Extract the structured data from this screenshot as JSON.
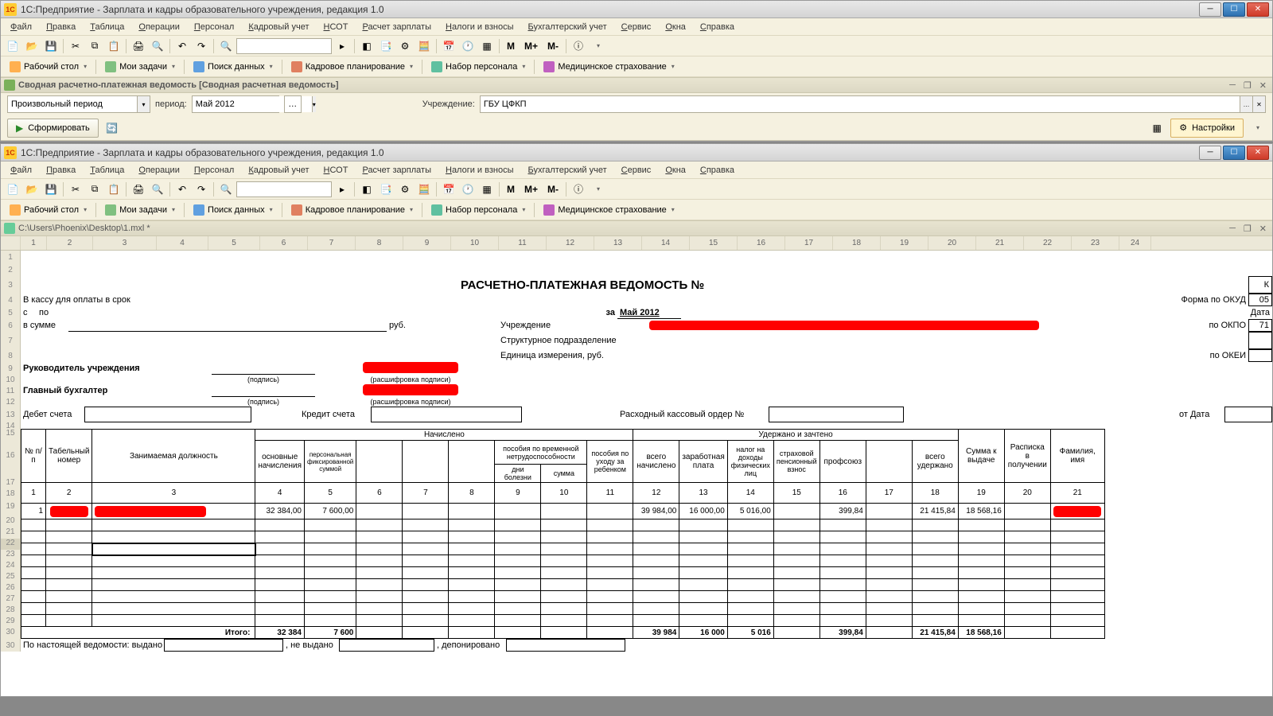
{
  "window1": {
    "title": "1С:Предприятие - Зарплата и кадры образовательного учреждения, редакция 1.0",
    "menu": [
      "Файл",
      "Правка",
      "Таблица",
      "Операции",
      "Персонал",
      "Кадровый учет",
      "НСОТ",
      "Расчет зарплаты",
      "Налоги и взносы",
      "Бухгалтерский учет",
      "Сервис",
      "Окна",
      "Справка"
    ],
    "toolbar_m": [
      "M",
      "M+",
      "M-"
    ],
    "toolbar2": [
      {
        "label": "Рабочий стол"
      },
      {
        "label": "Мои задачи"
      },
      {
        "label": "Поиск данных"
      },
      {
        "label": "Кадровое планирование"
      },
      {
        "label": "Набор персонала"
      },
      {
        "label": "Медицинское страхование"
      }
    ],
    "subwin": {
      "title": "Сводная расчетно-платежная ведомость [Сводная расчетная ведомость]",
      "period_type": "Произвольный период",
      "period_label": "период:",
      "period_value": "Май 2012",
      "org_label": "Учреждение:",
      "org_value": "ГБУ ЦФКП",
      "form_btn": "Сформировать",
      "settings_btn": "Настройки"
    }
  },
  "window2": {
    "title": "1С:Предприятие - Зарплата и кадры образовательного учреждения, редакция 1.0",
    "doc_path": "C:\\Users\\Phoenix\\Desktop\\1.mxl *",
    "sheet": {
      "col_headers": [
        "1",
        "2",
        "3",
        "4",
        "5",
        "6",
        "7",
        "8",
        "9",
        "10",
        "11",
        "12",
        "13",
        "14",
        "15",
        "16",
        "17",
        "18",
        "19",
        "20",
        "21",
        "22",
        "23",
        "24"
      ],
      "title": "РАСЧЕТНО-ПЛАТЕЖНАЯ ВЕДОМОСТЬ №",
      "r4": "В кассу для оплаты в срок",
      "r5a": "с",
      "r5b": "по",
      "r5_za": "за",
      "r5_month": "Май 2012",
      "r6a": "в сумме",
      "r6_rub": "руб.",
      "r6_org": "Учреждение",
      "r7_dept": "Структурное подразделение",
      "r8_unit": "Единица измерения, руб.",
      "r9_head": "Руководитель учреждения",
      "r_sign": "(подпись)",
      "r_decode": "(расшифровка подписи)",
      "r11_acc": "Главный бухгалтер",
      "r13_debit": "Дебет счета",
      "r13_credit": "Кредит счета",
      "r13_rko": "Расходный кассовый ордер №",
      "r13_date": "от Дата",
      "form_okud": "Форма по ОКУД",
      "okud_val": "05",
      "date_lbl": "Дата",
      "okpo_lbl": "по ОКПО",
      "okpo_val": "71",
      "okei_lbl": "по ОКЕИ",
      "table": {
        "group_accrued": "Начислено",
        "group_withheld": "Удержано и зачтено",
        "cols": {
          "num": "№ п/п",
          "tab_num": "Табельный номер",
          "position": "Занимаемая должность",
          "base": "основные начисления",
          "fixed": "персональная фиксированной суммой",
          "sick_group": "пособия по временной нетрудоспособности",
          "sick_days": "дни болезни",
          "sick_sum": "сумма",
          "child": "пособия по уходу за ребенком",
          "total_acc": "всего начислено",
          "salary": "заработная плата",
          "ndfl": "налог на доходы физических лиц",
          "pension": "страховой пенсионный взнос",
          "union": "профсоюз",
          "total_with": "всего удержано",
          "payout": "Сумма к выдаче",
          "receipt": "Расписка в получении",
          "fio": "Фамилия, имя"
        },
        "col_nums": [
          "1",
          "2",
          "3",
          "4",
          "5",
          "6",
          "7",
          "8",
          "9",
          "10",
          "11",
          "12",
          "13",
          "14",
          "15",
          "16",
          "17",
          "18",
          "19",
          "20",
          "21"
        ],
        "row1": {
          "num": "1",
          "base": "32 384,00",
          "fixed": "7 600,00",
          "total_acc": "39 984,00",
          "salary": "16 000,00",
          "ndfl": "5 016,00",
          "union": "399,84",
          "total_with": "21 415,84",
          "payout": "18 568,16"
        },
        "totals_label": "Итого:",
        "totals": {
          "base": "32 384",
          "fixed": "7 600",
          "total_acc": "39 984",
          "salary": "16 000",
          "ndfl": "5 016",
          "union": "399,84",
          "total_with": "21 415,84",
          "payout": "18 568,16"
        },
        "footer": {
          "issued": "По настоящей ведомости: выдано",
          "not_issued": ", не выдано",
          "deposited": ", депонировано"
        }
      }
    }
  }
}
